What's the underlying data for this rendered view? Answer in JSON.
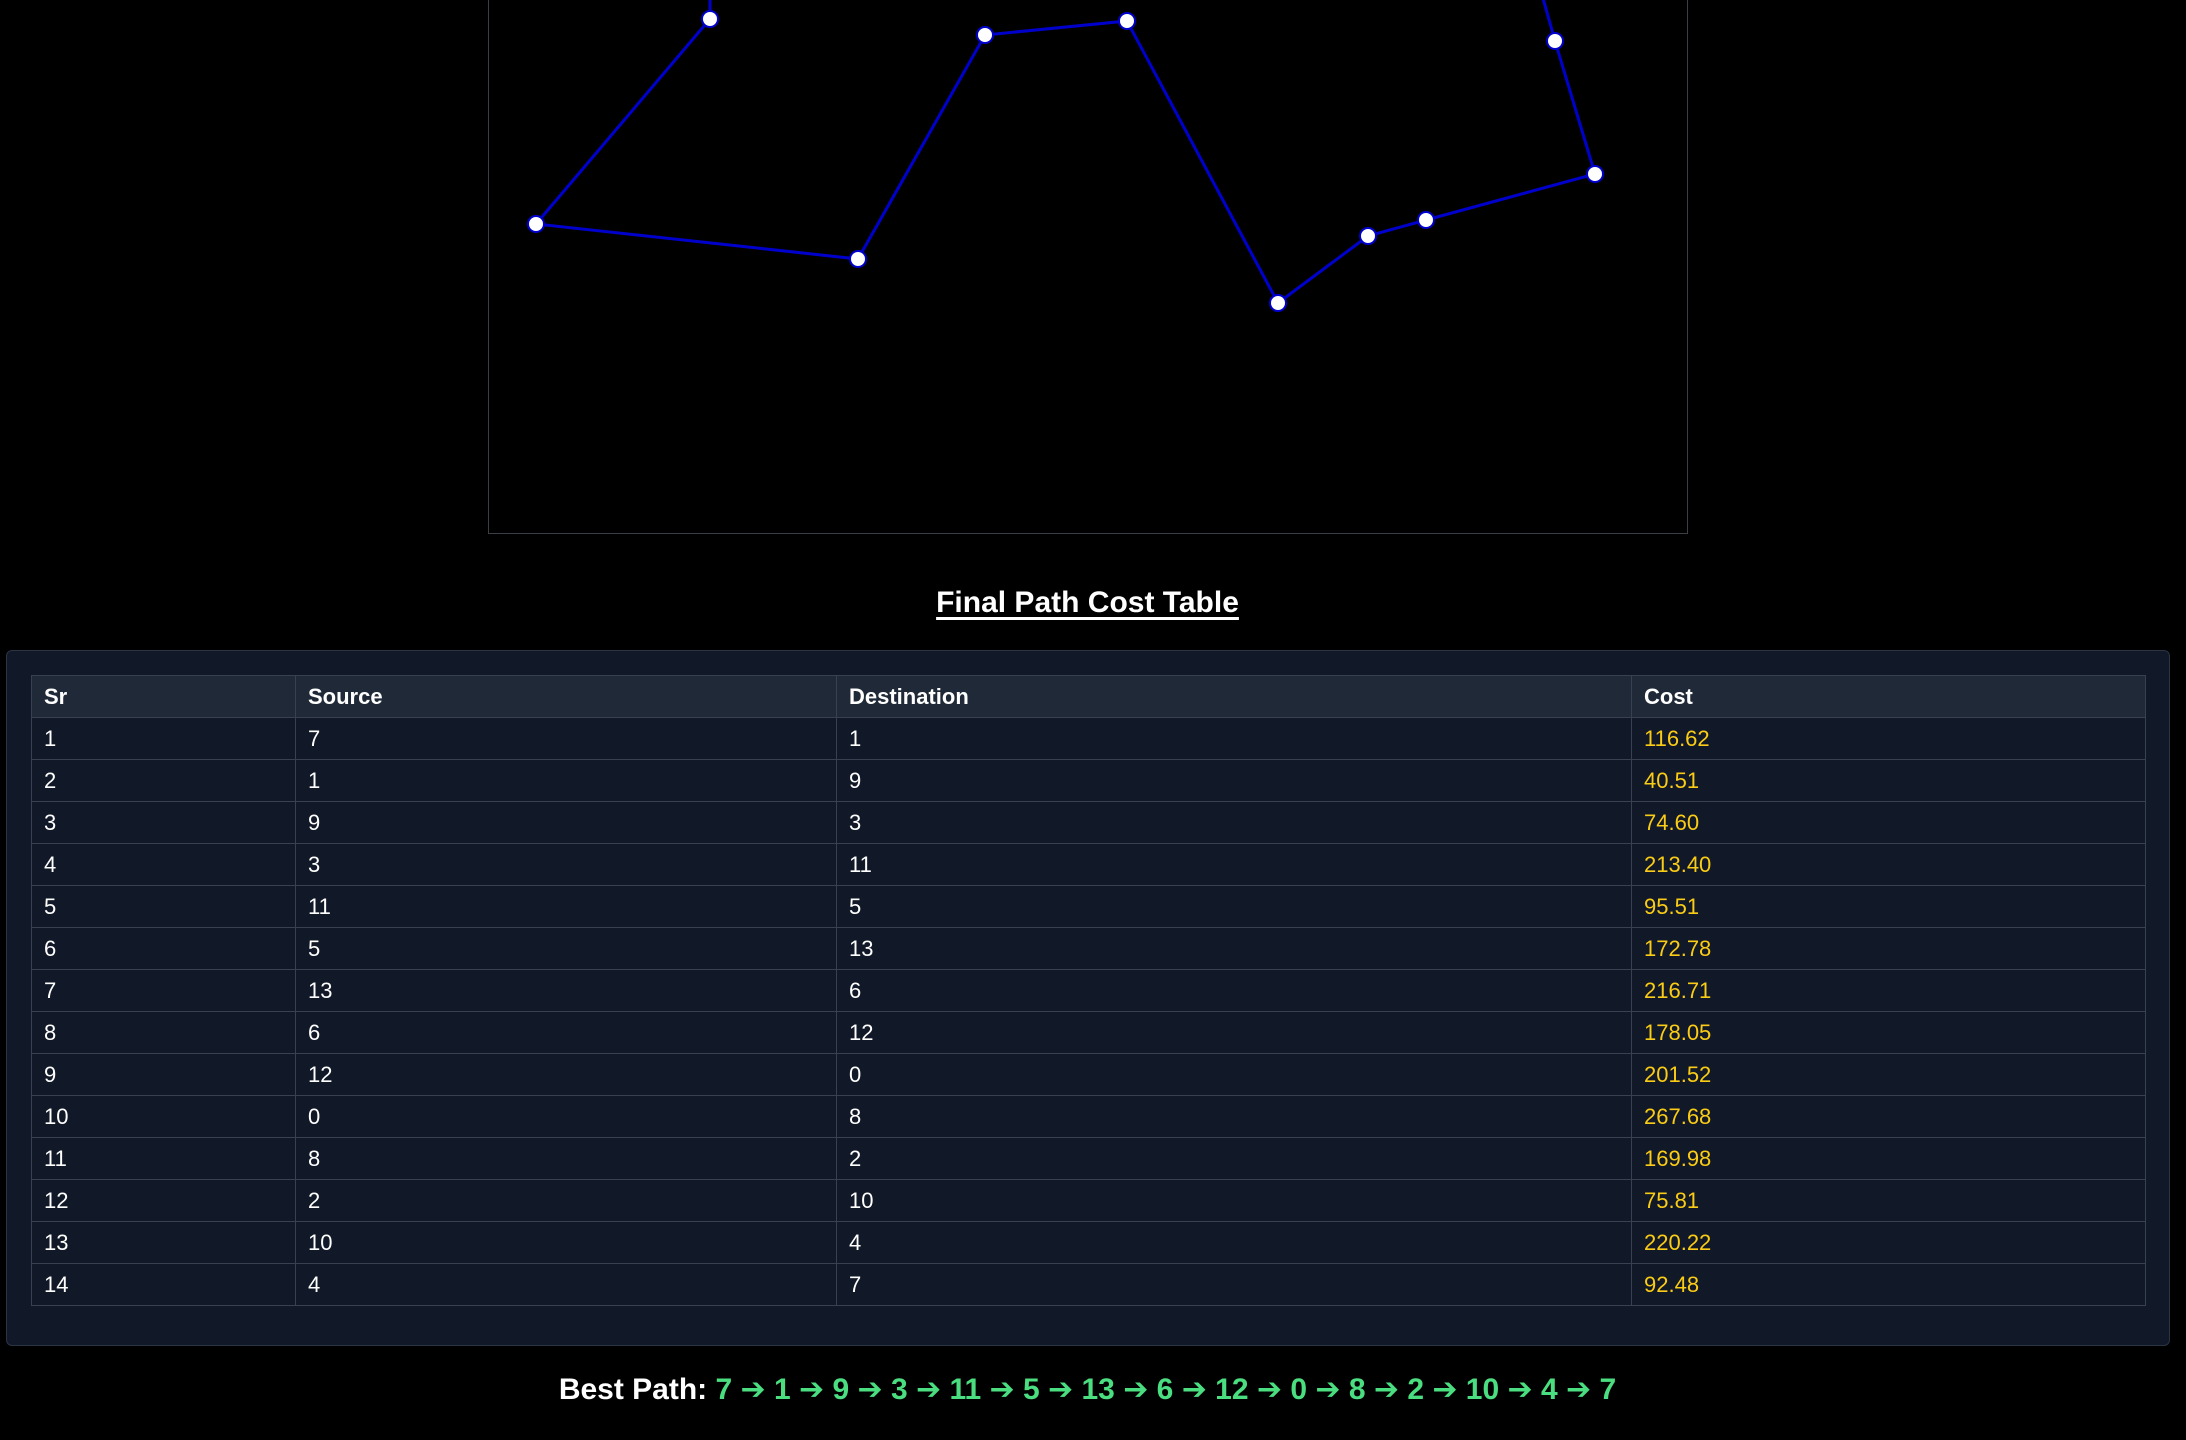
{
  "graph": {
    "edge_color": "#0000cc",
    "node_fill": "#ffffff",
    "node_stroke": "#0000cc"
  },
  "table": {
    "title": "Final Path Cost Table",
    "headers": [
      "Sr",
      "Source",
      "Destination",
      "Cost"
    ],
    "rows": [
      {
        "sr": "1",
        "source": "7",
        "destination": "1",
        "cost": "116.62"
      },
      {
        "sr": "2",
        "source": "1",
        "destination": "9",
        "cost": "40.51"
      },
      {
        "sr": "3",
        "source": "9",
        "destination": "3",
        "cost": "74.60"
      },
      {
        "sr": "4",
        "source": "3",
        "destination": "11",
        "cost": "213.40"
      },
      {
        "sr": "5",
        "source": "11",
        "destination": "5",
        "cost": "95.51"
      },
      {
        "sr": "6",
        "source": "5",
        "destination": "13",
        "cost": "172.78"
      },
      {
        "sr": "7",
        "source": "13",
        "destination": "6",
        "cost": "216.71"
      },
      {
        "sr": "8",
        "source": "6",
        "destination": "12",
        "cost": "178.05"
      },
      {
        "sr": "9",
        "source": "12",
        "destination": "0",
        "cost": "201.52"
      },
      {
        "sr": "10",
        "source": "0",
        "destination": "8",
        "cost": "267.68"
      },
      {
        "sr": "11",
        "source": "8",
        "destination": "2",
        "cost": "169.98"
      },
      {
        "sr": "12",
        "source": "2",
        "destination": "10",
        "cost": "75.81"
      },
      {
        "sr": "13",
        "source": "10",
        "destination": "4",
        "cost": "220.22"
      },
      {
        "sr": "14",
        "source": "4",
        "destination": "7",
        "cost": "92.48"
      }
    ],
    "cost_color": "#facc15"
  },
  "best_path": {
    "label": "Best Path:",
    "value": "7 ➔ 1 ➔ 9 ➔ 3 ➔ 11 ➔ 5 ➔ 13 ➔ 6 ➔ 12 ➔ 0 ➔ 8 ➔ 2 ➔ 10 ➔ 4 ➔ 7",
    "color": "#4ade80"
  }
}
